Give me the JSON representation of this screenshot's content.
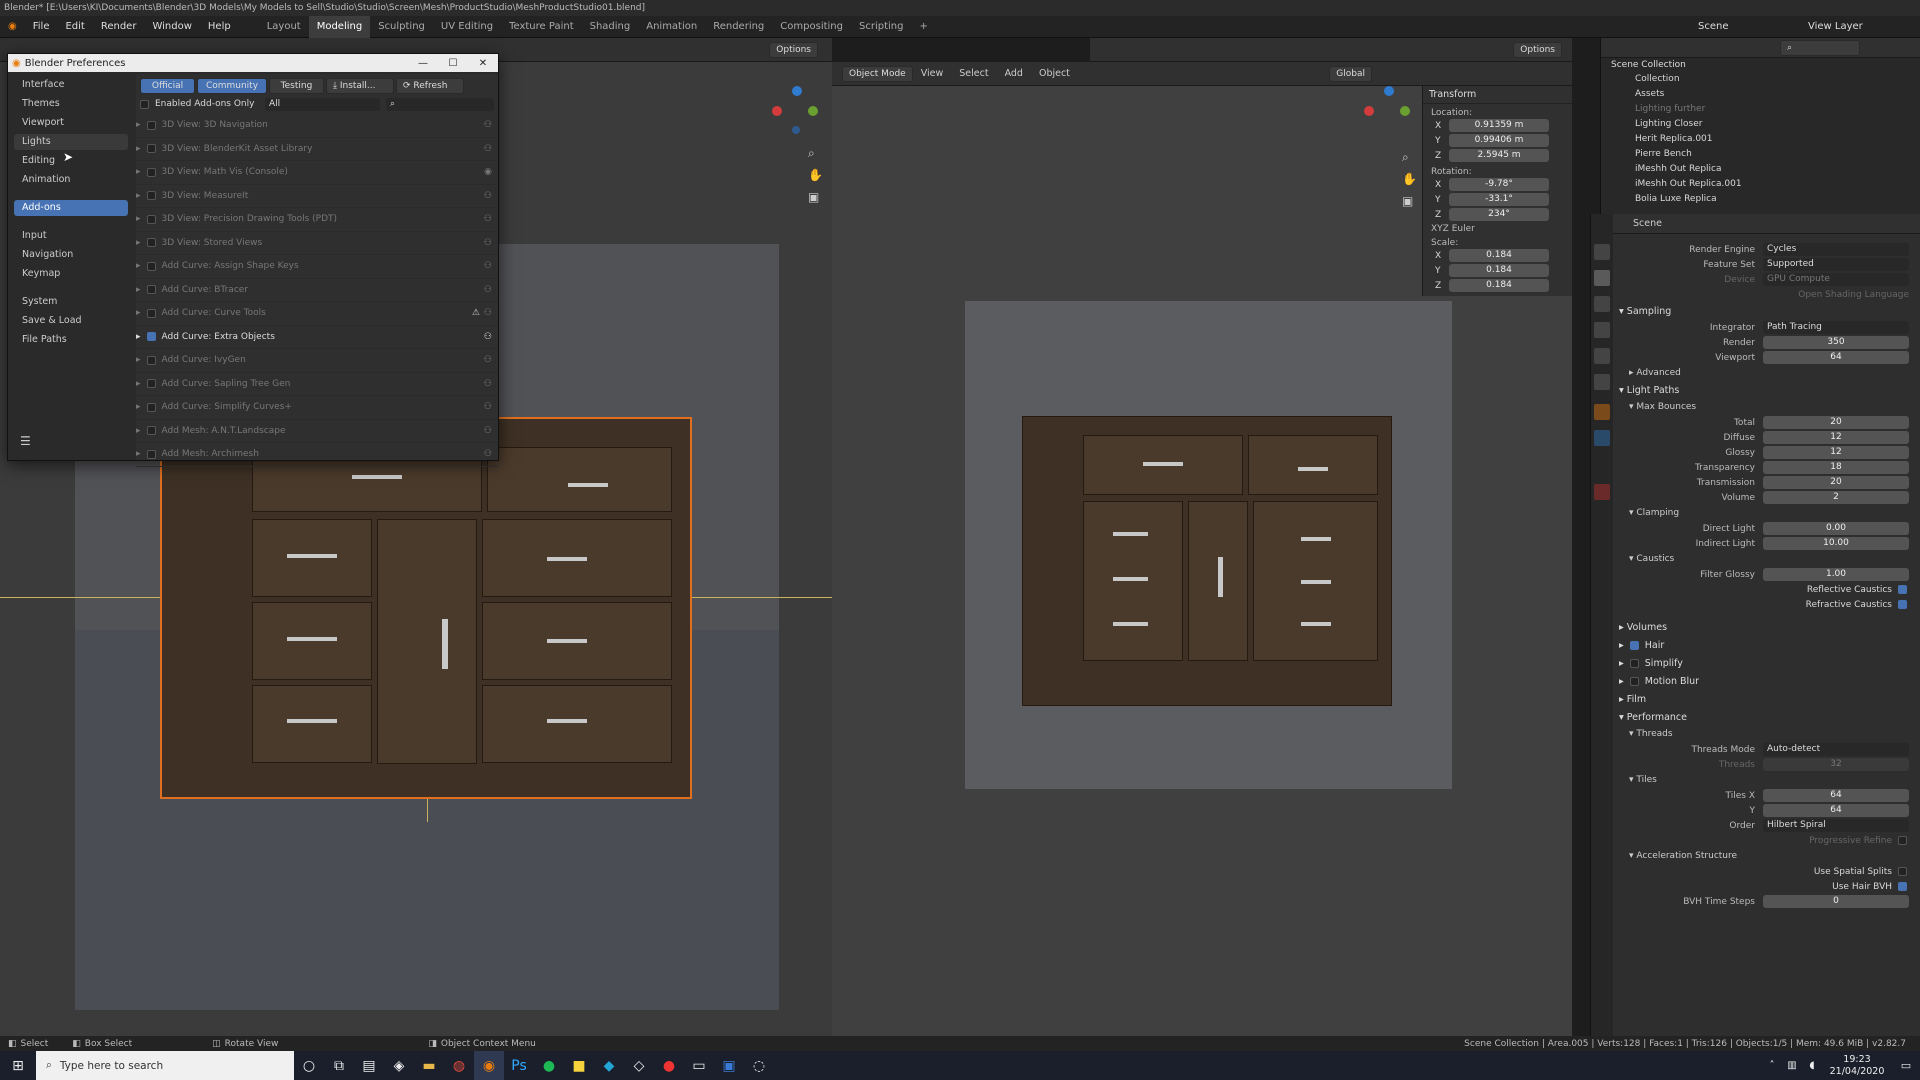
{
  "window": {
    "title": "Blender* [E:\\Users\\KI\\Documents\\Blender\\3D Models\\My Models to Sell\\Studio\\Studio\\Screen\\Mesh\\ProductStudio\\MeshProductStudio01.blend]"
  },
  "menu": {
    "items": [
      "File",
      "Edit",
      "Render",
      "Window",
      "Help"
    ],
    "tabs": [
      "Layout",
      "Modeling",
      "Sculpting",
      "UV Editing",
      "Texture Paint",
      "Shading",
      "Animation",
      "Rendering",
      "Compositing",
      "Scripting"
    ],
    "active_tab": "Modeling",
    "scene": "Scene",
    "view_layer": "View Layer"
  },
  "viewport_left": {
    "options": "Options",
    "transform_orientation": "Global"
  },
  "viewport_right": {
    "mode": "Object Mode",
    "menus": [
      "View",
      "Select",
      "Add",
      "Object"
    ],
    "orientation": "Global",
    "options": "Options"
  },
  "prefs": {
    "title": "Blender Preferences",
    "sidebar": [
      "Interface",
      "Themes",
      "Viewport",
      "Lights",
      "Editing",
      "Animation",
      "Add-ons",
      "Input",
      "Navigation",
      "Keymap",
      "System",
      "Save & Load",
      "File Paths"
    ],
    "active": "Add-ons",
    "tabs": [
      "Official",
      "Community",
      "Testing"
    ],
    "install": "Install...",
    "refresh": "Refresh",
    "enabled_only": "Enabled Add-ons Only",
    "filter": "All",
    "addons": [
      {
        "name": "3D View: 3D Navigation",
        "on": false
      },
      {
        "name": "3D View: BlenderKit Asset Library",
        "on": false
      },
      {
        "name": "3D View: Math Vis (Console)",
        "on": false
      },
      {
        "name": "3D View: MeasureIt",
        "on": false
      },
      {
        "name": "3D View: Precision Drawing Tools (PDT)",
        "on": false
      },
      {
        "name": "3D View: Stored Views",
        "on": false
      },
      {
        "name": "Add Curve: Assign Shape Keys",
        "on": false
      },
      {
        "name": "Add Curve: BTracer",
        "on": false
      },
      {
        "name": "Add Curve: Curve Tools",
        "on": false
      },
      {
        "name": "Add Curve: Extra Objects",
        "on": true
      },
      {
        "name": "Add Curve: IvyGen",
        "on": false
      },
      {
        "name": "Add Curve: Sapling Tree Gen",
        "on": false
      },
      {
        "name": "Add Curve: Simplify Curves+",
        "on": false
      },
      {
        "name": "Add Mesh: A.N.T.Landscape",
        "on": false
      },
      {
        "name": "Add Mesh: Archimesh",
        "on": false
      }
    ]
  },
  "transform": {
    "title": "Transform",
    "location_label": "Location:",
    "location": [
      {
        "axis": "X",
        "value": "0.91359 m"
      },
      {
        "axis": "Y",
        "value": "0.99406 m"
      },
      {
        "axis": "Z",
        "value": "2.5945 m"
      }
    ],
    "rotation_label": "Rotation:",
    "rotation": [
      {
        "axis": "X",
        "value": "-9.78°"
      },
      {
        "axis": "Y",
        "value": "-33.1°"
      },
      {
        "axis": "Z",
        "value": "234°"
      }
    ],
    "rotation_mode": "XYZ Euler",
    "scale_label": "Scale:",
    "scale": [
      {
        "axis": "X",
        "value": "0.184"
      },
      {
        "axis": "Y",
        "value": "0.184"
      },
      {
        "axis": "Z",
        "value": "0.184"
      }
    ]
  },
  "outliner": {
    "root": "Scene Collection",
    "items": [
      "Collection",
      "Assets",
      "Lighting further",
      "Lighting Closer",
      "Herit Replica.001",
      "Pierre Bench",
      "iMeshh Out Replica",
      "iMeshh Out Replica.001",
      "Bolia Luxe Replica"
    ]
  },
  "properties": {
    "scene_label": "Scene",
    "render_engine_label": "Render Engine",
    "render_engine": "Cycles",
    "feature_set_label": "Feature Set",
    "feature_set": "Supported",
    "device_label": "Device",
    "device": "GPU Compute",
    "osl": "Open Shading Language",
    "sampling": "Sampling",
    "integrator_label": "Integrator",
    "integrator": "Path Tracing",
    "render_label": "Render",
    "render": "350",
    "viewport_label": "Viewport",
    "viewport": "64",
    "advanced": "Advanced",
    "light_paths": "Light Paths",
    "max_bounces": "Max Bounces",
    "bounces": [
      {
        "label": "Total",
        "value": "20"
      },
      {
        "label": "Diffuse",
        "value": "12"
      },
      {
        "label": "Glossy",
        "value": "12"
      },
      {
        "label": "Transparency",
        "value": "18"
      },
      {
        "label": "Transmission",
        "value": "20"
      },
      {
        "label": "Volume",
        "value": "2"
      }
    ],
    "clamping": "Clamping",
    "direct_light_label": "Direct Light",
    "direct_light": "0.00",
    "indirect_light_label": "Indirect Light",
    "indirect_light": "10.00",
    "caustics": "Caustics",
    "filter_glossy_label": "Filter Glossy",
    "filter_glossy": "1.00",
    "reflective": "Reflective Caustics",
    "refractive": "Refractive Caustics",
    "volumes": "Volumes",
    "hair": "Hair",
    "simplify": "Simplify",
    "motion_blur": "Motion Blur",
    "film": "Film",
    "performance": "Performance",
    "threads": "Threads",
    "threads_mode_label": "Threads Mode",
    "threads_mode": "Auto-detect",
    "threads_label": "Threads",
    "threads_val": "32",
    "tiles": "Tiles",
    "tiles_x_label": "Tiles X",
    "tiles_x": "64",
    "tiles_y_label": "Y",
    "tiles_y": "64",
    "order_label": "Order",
    "order": "Hilbert Spiral",
    "progressive": "Progressive Refine",
    "accel": "Acceleration Structure",
    "spatial": "Use Spatial Splits",
    "hair_bvh": "Use Hair BVH",
    "bvh_steps_label": "BVH Time Steps",
    "bvh_steps": "0"
  },
  "statusbar": {
    "select": "Select",
    "box_select": "Box Select",
    "rotate": "Rotate View",
    "context": "Object Context Menu",
    "stats": "Scene Collection | Area.005 | Verts:128 | Faces:1 | Tris:126 | Objects:1/5 | Mem: 49.6 MiB | v2.82.7"
  },
  "taskbar": {
    "search": "Type here to search",
    "time": "19:23",
    "date": "21/04/2020"
  }
}
